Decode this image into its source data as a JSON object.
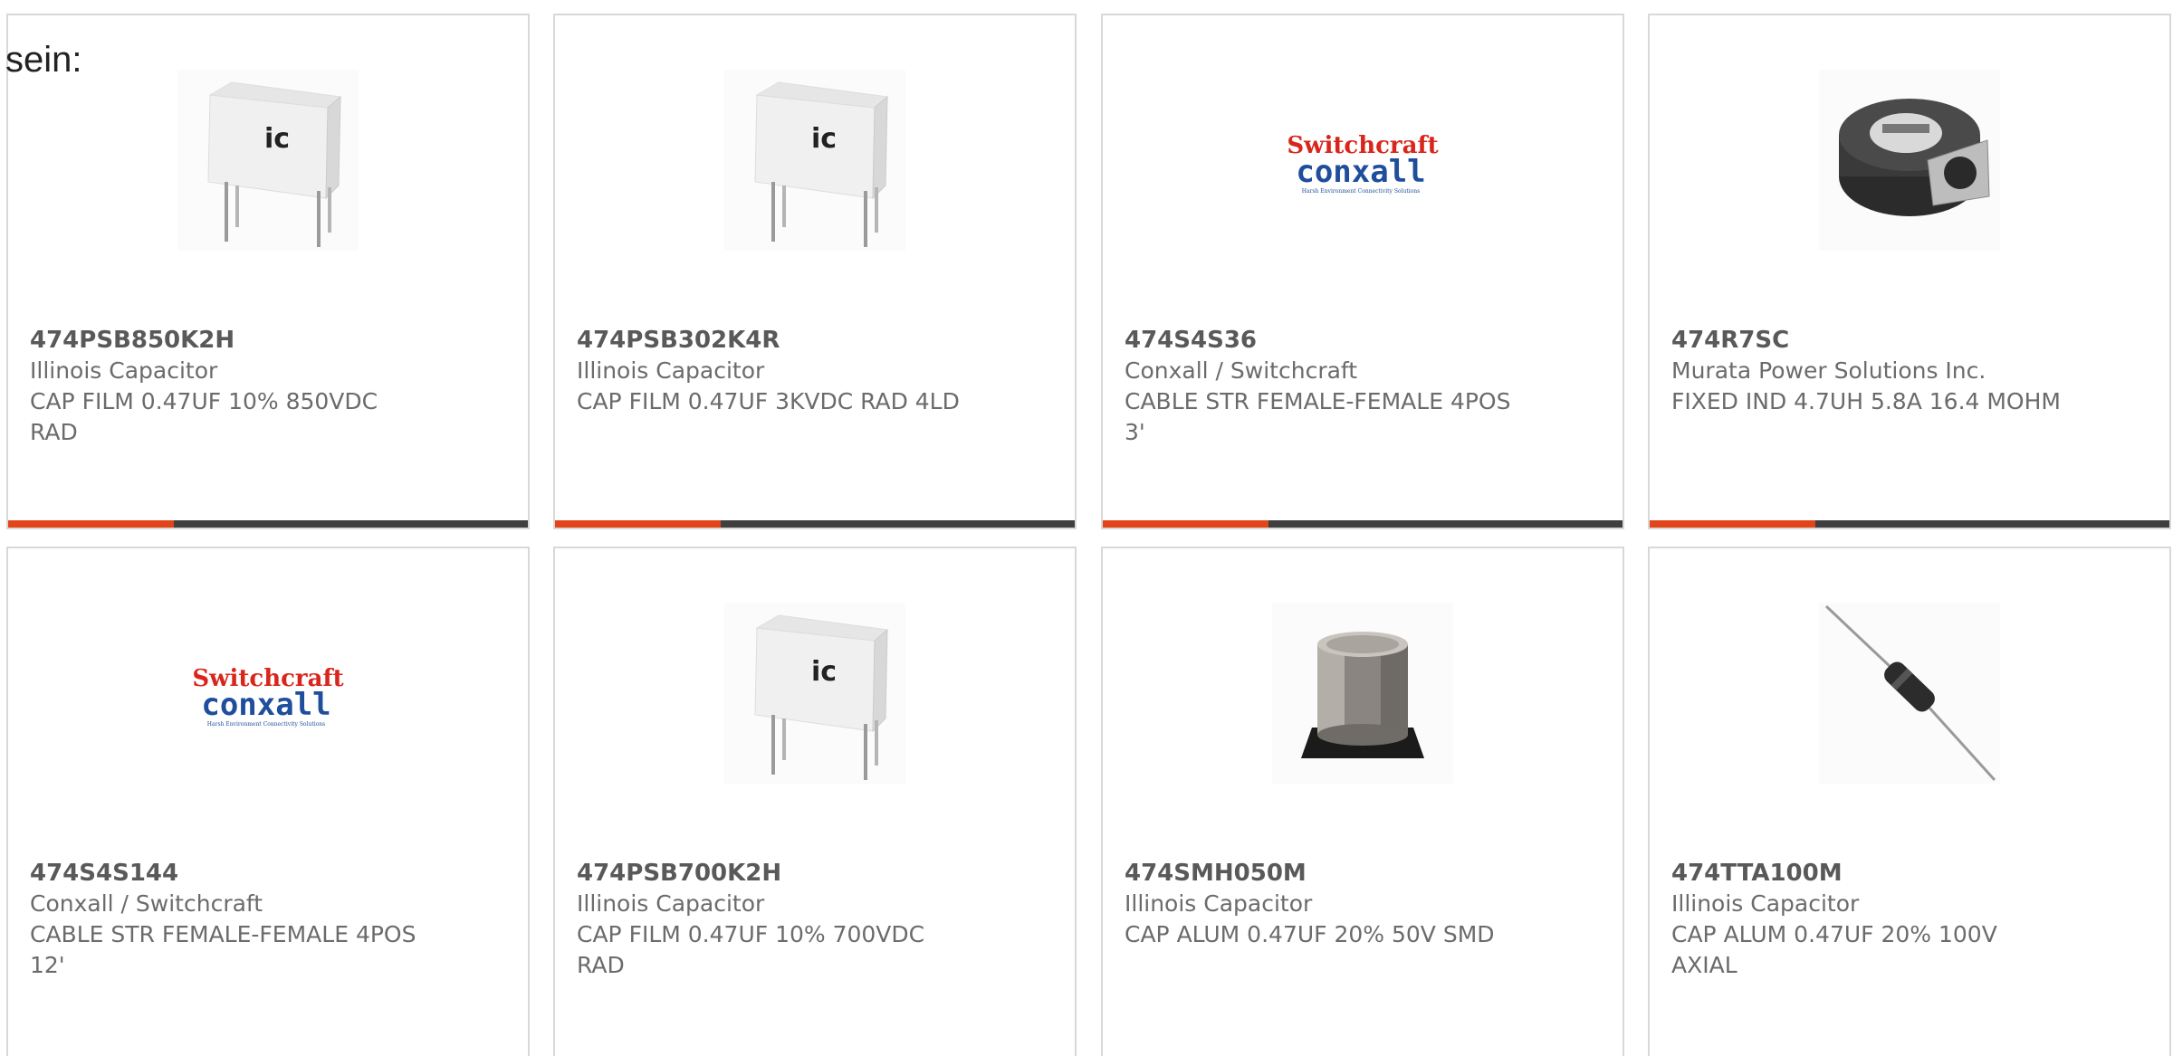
{
  "intro": {
    "text": "sein:"
  },
  "products": [
    {
      "part_number": "474PSB850K2H",
      "manufacturer": "Illinois Capacitor",
      "description": "CAP FILM 0.47UF 10% 850VDC RAD",
      "image": "ic-film-capacitor",
      "bar": true
    },
    {
      "part_number": "474PSB302K4R",
      "manufacturer": "Illinois Capacitor",
      "description": "CAP FILM 0.47UF 3KVDC RAD 4LD",
      "image": "ic-film-capacitor",
      "bar": true
    },
    {
      "part_number": "474S4S36",
      "manufacturer": "Conxall / Switchcraft",
      "description": "CABLE STR FEMALE-FEMALE 4POS 3'",
      "image": "switchcraft-conxall-logo",
      "bar": true
    },
    {
      "part_number": "474R7SC",
      "manufacturer": "Murata Power Solutions Inc.",
      "description": "FIXED IND 4.7UH 5.8A 16.4 MOHM",
      "image": "smd-inductor",
      "bar": true
    },
    {
      "part_number": "474S4S144",
      "manufacturer": "Conxall / Switchcraft",
      "description": "CABLE STR FEMALE-FEMALE 4POS 12'",
      "image": "switchcraft-conxall-logo",
      "bar": false
    },
    {
      "part_number": "474PSB700K2H",
      "manufacturer": "Illinois Capacitor",
      "description": "CAP FILM 0.47UF 10% 700VDC RAD",
      "image": "ic-film-capacitor",
      "bar": false
    },
    {
      "part_number": "474SMH050M",
      "manufacturer": "Illinois Capacitor",
      "description": "CAP ALUM 0.47UF 20% 50V SMD",
      "image": "smd-electrolytic-capacitor",
      "bar": false
    },
    {
      "part_number": "474TTA100M",
      "manufacturer": "Illinois Capacitor",
      "description": "CAP ALUM 0.47UF 20% 100V AXIAL",
      "image": "axial-capacitor",
      "bar": false
    }
  ],
  "logo_text": {
    "brand_top": "Switchcraft",
    "brand_bottom": "conxall",
    "tagline": "Harsh Environment Connectivity Solutions",
    "ic_mark": "ic"
  },
  "colors": {
    "accent": "#e2451a",
    "bar": "#3f3f3f",
    "switchcraft_red": "#d9261c",
    "conxall_blue": "#1f4e9c"
  }
}
